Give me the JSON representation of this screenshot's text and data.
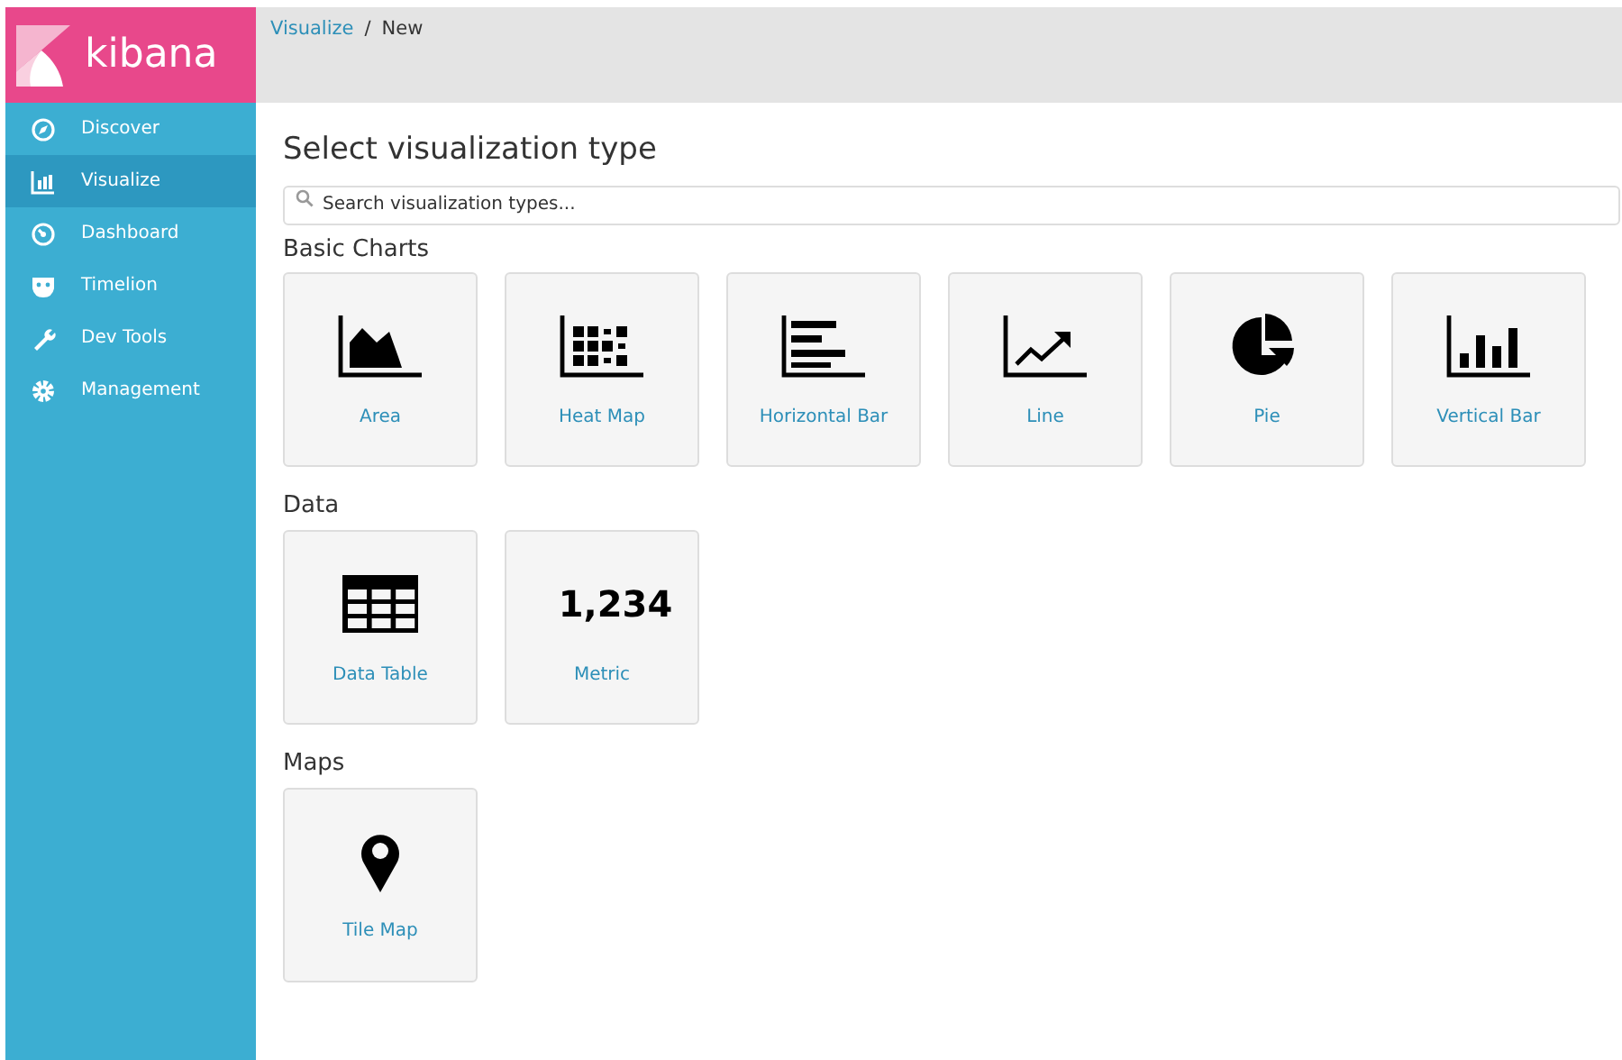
{
  "brand": {
    "name": "kibana"
  },
  "sidebar": {
    "items": [
      {
        "label": "Discover",
        "kind": "compass",
        "selected": false
      },
      {
        "label": "Visualize",
        "kind": "barchart",
        "selected": true
      },
      {
        "label": "Dashboard",
        "kind": "gauge",
        "selected": false
      },
      {
        "label": "Timelion",
        "kind": "mask",
        "selected": false
      },
      {
        "label": "Dev Tools",
        "kind": "wrench",
        "selected": false
      },
      {
        "label": "Management",
        "kind": "gear",
        "selected": false
      }
    ]
  },
  "breadcrumbs": [
    {
      "label": "Visualize",
      "link": true
    },
    {
      "label": "/",
      "link": false
    },
    {
      "label": "New",
      "link": false
    }
  ],
  "title": "Select visualization type",
  "search": {
    "placeholder": "Search visualization types..."
  },
  "sections": [
    {
      "heading": "Basic Charts",
      "tiles": [
        {
          "label": "Area",
          "kind": "area"
        },
        {
          "label": "Heat Map",
          "kind": "heatmap"
        },
        {
          "label": "Horizontal Bar",
          "kind": "hbar"
        },
        {
          "label": "Line",
          "kind": "line"
        },
        {
          "label": "Pie",
          "kind": "pie"
        },
        {
          "label": "Vertical Bar",
          "kind": "vbar"
        }
      ]
    },
    {
      "heading": "Data",
      "tiles": [
        {
          "label": "Data Table",
          "kind": "table"
        },
        {
          "label": "Metric",
          "kind": "metric",
          "preview": "1,234"
        }
      ]
    },
    {
      "heading": "Maps",
      "tiles": [
        {
          "label": "Tile Map",
          "kind": "pin"
        }
      ]
    }
  ]
}
